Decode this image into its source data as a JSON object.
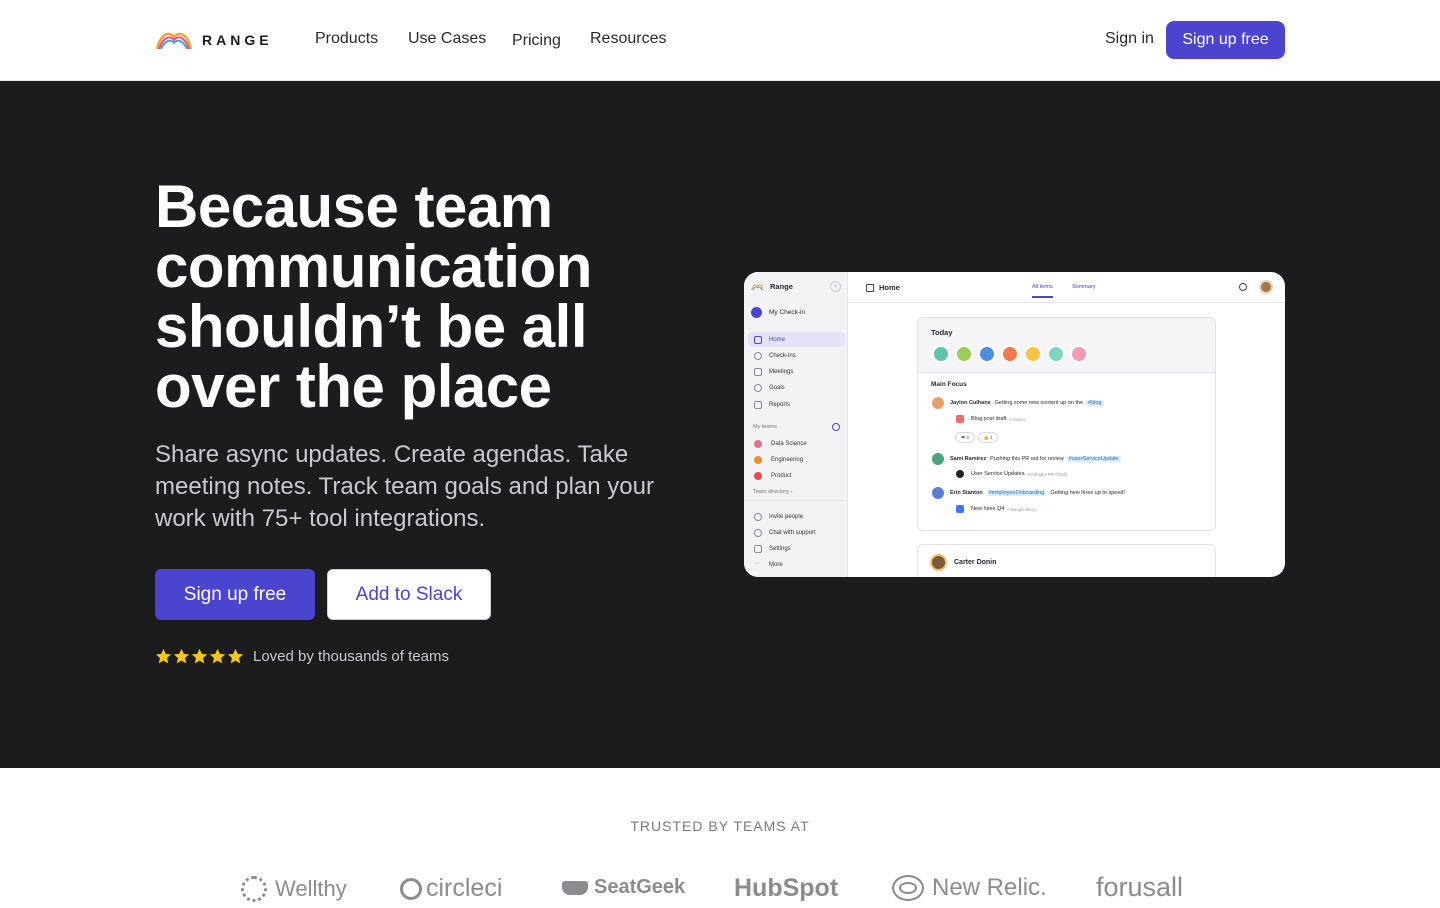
{
  "nav": {
    "logo_text": "RANGE",
    "links": [
      "Products",
      "Use Cases",
      "Pricing",
      "Resources"
    ],
    "sign_in": "Sign in",
    "cta": "Sign up free"
  },
  "hero": {
    "title": "Because team communication shouldn’t be all over the place",
    "subtitle": "Share async updates. Create agendas. Take meeting notes. Track team goals and plan your work with 75+ tool integrations.",
    "primary_button": "Sign up free",
    "secondary_button": "Add to Slack",
    "rating": {
      "stars": 5,
      "text": "Loved by thousands of teams"
    }
  },
  "app": {
    "brand": "Range",
    "collapse_icon": "‹",
    "my_checkin": "My Check-in",
    "sidebar_items": [
      {
        "label": "Home",
        "icon": "home-icon",
        "active": true
      },
      {
        "label": "Check-ins",
        "icon": "check-circle-icon"
      },
      {
        "label": "Meetings",
        "icon": "meetings-icon"
      },
      {
        "label": "Goals",
        "icon": "target-icon"
      },
      {
        "label": "Reports",
        "icon": "report-icon"
      }
    ],
    "my_teams_label": "My teams",
    "teams": [
      {
        "label": "Data Science",
        "color": "#e8708f"
      },
      {
        "label": "Engineering",
        "color": "#f28b2b"
      },
      {
        "label": "Product",
        "color": "#e84b4b"
      }
    ],
    "team_directory": "Team directory ›",
    "footer_items": [
      {
        "label": "Invite people",
        "icon": "invite-icon"
      },
      {
        "label": "Chat with support",
        "icon": "chat-icon"
      },
      {
        "label": "Settings",
        "icon": "settings-icon"
      },
      {
        "label": "More",
        "icon": "more-icon"
      }
    ],
    "page_title": "Home",
    "tabs": [
      "All items",
      "Summary"
    ],
    "today_label": "Today",
    "avatar_colors": [
      "#5ec3a8",
      "#9ccc5a",
      "#4f8fe0",
      "#f07a4a",
      "#f5c542",
      "#7fd3c1",
      "#f29ab0"
    ],
    "main_focus": "Main Focus",
    "feed": [
      {
        "name": "Jaylon Culhane",
        "text": "Getting some new content up on the",
        "tag": "#blog",
        "tag_first": false,
        "avatar": "#e8a06a",
        "sub": {
          "label": "Blog post draft",
          "source": "• Asana",
          "icon_color": "#f06a6a"
        }
      },
      {
        "name": "Sami Ramirez",
        "text": "Pushing this PR out for review",
        "tag": "#userServiceUpdate",
        "tag_first": false,
        "avatar": "#4aa37b",
        "sub": {
          "label": "User Service Updates",
          "source": "• Github • PR #1844",
          "icon_color": "#222222"
        }
      },
      {
        "name": "Erin Stanton",
        "text": "Getting new hires up to speed!",
        "tag": "#employeeOnboarding",
        "tag_first": true,
        "avatar": "#5a7fd0",
        "sub": {
          "label": "New hires Q4",
          "source": "• Google Docs",
          "icon_color": "#3b7bf0"
        }
      }
    ],
    "reactions": [
      "❤ 3",
      "👍 1"
    ],
    "next_card_name": "Carter Donin"
  },
  "trusted": {
    "heading": "TRUSTED BY TEAMS AT",
    "logos": [
      "Wellthy",
      "circleci",
      "SeatGeek",
      "HubSpot",
      "New Relic.",
      "forusall"
    ]
  },
  "colors": {
    "accent": "#4b44cf",
    "hero_bg": "#1c1c1f",
    "star": "#f5c518"
  }
}
